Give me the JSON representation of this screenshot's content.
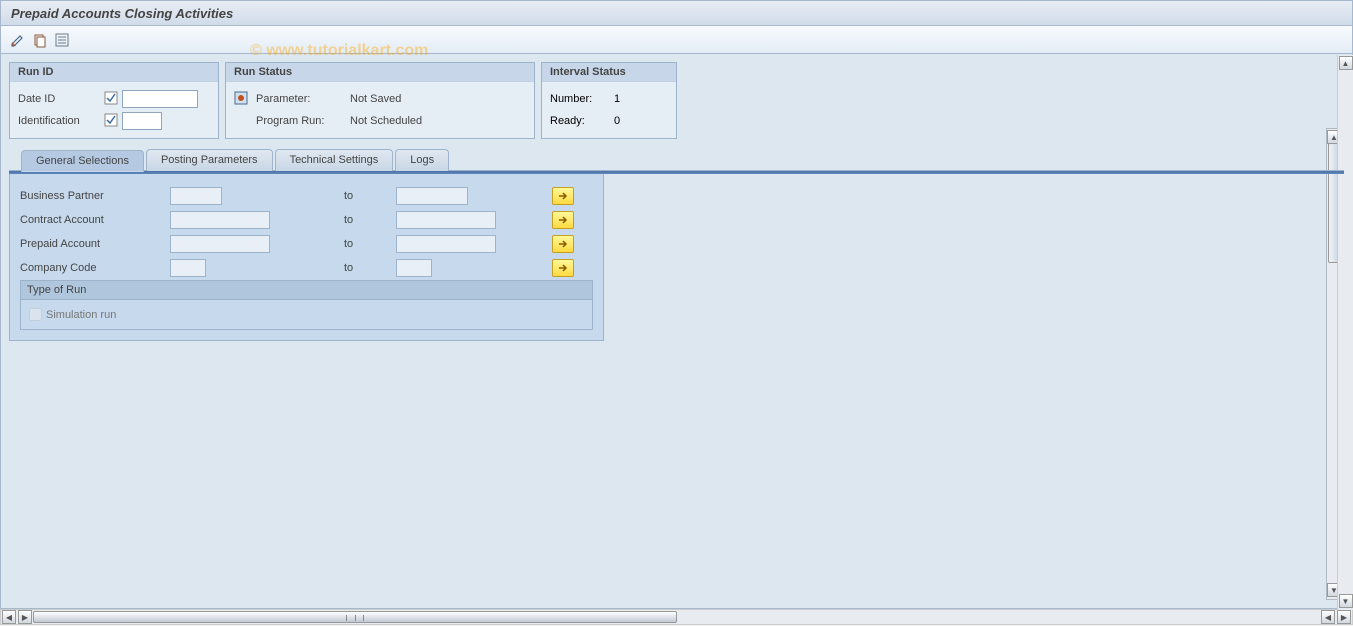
{
  "title": "Prepaid Accounts Closing Activities",
  "watermark": "© www.tutorialkart.com",
  "toolbar": {
    "icon1": "edit-icon",
    "icon2": "copy-icon",
    "icon3": "list-icon"
  },
  "panels": {
    "runId": {
      "title": "Run ID",
      "fields": {
        "dateId": {
          "label": "Date ID",
          "value": ""
        },
        "identification": {
          "label": "Identification",
          "value": ""
        }
      }
    },
    "runStatus": {
      "title": "Run Status",
      "rows": {
        "parameter": {
          "label": "Parameter:",
          "value": "Not Saved"
        },
        "programRun": {
          "label": "Program Run:",
          "value": "Not Scheduled"
        }
      }
    },
    "intervalStatus": {
      "title": "Interval Status",
      "rows": {
        "number": {
          "label": "Number:",
          "value": "1"
        },
        "ready": {
          "label": "Ready:",
          "value": "0"
        }
      }
    }
  },
  "tabs": {
    "generalSelections": "General Selections",
    "postingParameters": "Posting Parameters",
    "technicalSettings": "Technical Settings",
    "logs": "Logs"
  },
  "selections": {
    "businessPartner": {
      "label": "Business Partner",
      "to": "to"
    },
    "contractAccount": {
      "label": "Contract Account",
      "to": "to"
    },
    "prepaidAccount": {
      "label": "Prepaid Account",
      "to": "to"
    },
    "companyCode": {
      "label": "Company Code",
      "to": "to"
    }
  },
  "typeOfRun": {
    "title": "Type of Run",
    "simulation": {
      "label": "Simulation run",
      "checked": false
    }
  }
}
